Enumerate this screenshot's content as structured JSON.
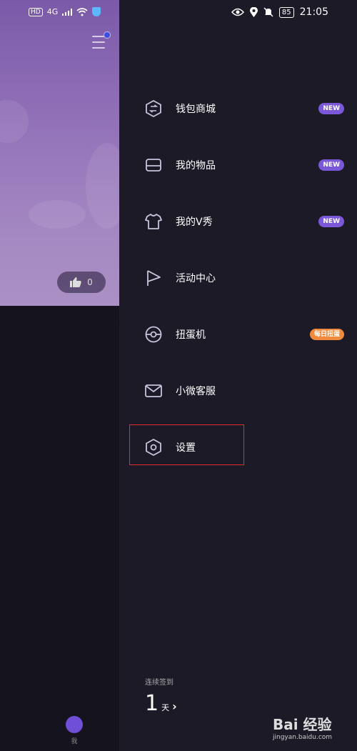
{
  "status_bar": {
    "left": {
      "hd": "HD",
      "network": "4G",
      "signal": "signal-icon",
      "wifi": "wifi-icon",
      "shield": "shield-icon"
    },
    "right": {
      "battery": "85",
      "time": "21:05"
    }
  },
  "background_post": {
    "like_count": "0",
    "tab_label": "我"
  },
  "drawer": {
    "items": [
      {
        "label": "钱包商城",
        "icon": "wallet-icon",
        "badge": "NEW"
      },
      {
        "label": "我的物品",
        "icon": "inbox-icon",
        "badge": "NEW"
      },
      {
        "label": "我的V秀",
        "icon": "shirt-icon",
        "badge": "NEW"
      },
      {
        "label": "活动中心",
        "icon": "flag-icon",
        "badge": ""
      },
      {
        "label": "扭蛋机",
        "icon": "capsule-icon",
        "badge": "每日扭蛋"
      },
      {
        "label": "小微客服",
        "icon": "mail-icon",
        "badge": ""
      },
      {
        "label": "设置",
        "icon": "settings-icon",
        "badge": ""
      }
    ],
    "streak": {
      "caption": "连续签到",
      "count": "1",
      "unit": "天",
      "chevron": "›"
    }
  },
  "watermark": {
    "brand": "Bai 经验",
    "url": "jingyan.baidu.com"
  },
  "colors": {
    "drawer_bg": "#1d1a27",
    "new_badge": "#7a58d8",
    "orange_badge": "#f08a3c",
    "highlight_box": "#e03030"
  }
}
